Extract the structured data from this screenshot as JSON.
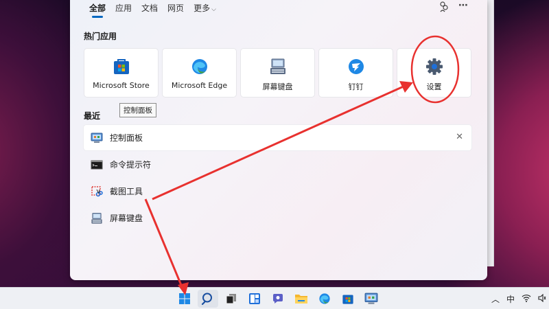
{
  "tabs": [
    {
      "label": "全部",
      "active": true
    },
    {
      "label": "应用"
    },
    {
      "label": "文档"
    },
    {
      "label": "网页"
    },
    {
      "label": "更多"
    }
  ],
  "top_icons": [
    "people-icon",
    "more-icon"
  ],
  "hot_apps": {
    "title": "热门应用",
    "items": [
      {
        "label": "Microsoft Store",
        "icon": "store-icon"
      },
      {
        "label": "Microsoft Edge",
        "icon": "edge-icon"
      },
      {
        "label": "屏幕键盘",
        "icon": "keyboard-icon"
      },
      {
        "label": "钉钉",
        "icon": "dingtalk-icon"
      },
      {
        "label": "设置",
        "icon": "gear-icon"
      }
    ]
  },
  "recent": {
    "title": "最近",
    "tooltip": "控制面板",
    "items": [
      {
        "label": "控制面板",
        "icon": "control-panel-icon"
      },
      {
        "label": "命令提示符",
        "icon": "cmd-icon"
      },
      {
        "label": "截图工具",
        "icon": "snipping-tool-icon"
      },
      {
        "label": "屏幕键盘",
        "icon": "keyboard-icon"
      }
    ]
  },
  "tray": {
    "ime": "中"
  },
  "colors": {
    "accent": "#0067c0",
    "annotation": "#e8312f"
  }
}
